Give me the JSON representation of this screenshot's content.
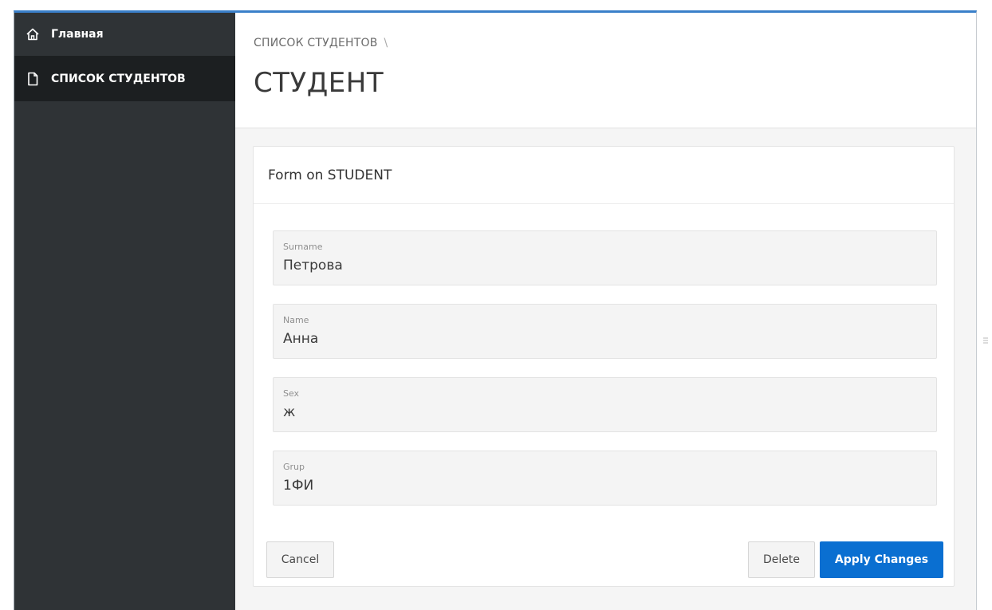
{
  "sidebar": {
    "items": [
      {
        "label": "Главная",
        "icon": "home-icon",
        "active": false
      },
      {
        "label": "СПИСОК СТУДЕНТОВ",
        "icon": "document-icon",
        "active": true
      }
    ]
  },
  "header": {
    "breadcrumb": "СПИСОК СТУДЕНТОВ",
    "breadcrumb_sep": "\\",
    "title": "СТУДЕНТ"
  },
  "form": {
    "title": "Form on STUDENT",
    "fields": [
      {
        "label": "Surname",
        "value": "Петрова"
      },
      {
        "label": "Name",
        "value": "Анна"
      },
      {
        "label": "Sex",
        "value": "ж"
      },
      {
        "label": "Grup",
        "value": "1ФИ"
      }
    ],
    "buttons": {
      "cancel": "Cancel",
      "delete": "Delete",
      "apply": "Apply Changes"
    }
  },
  "colors": {
    "sidebar_bg": "#2f3336",
    "active_item_bg": "#1c1f21",
    "primary_button": "#0a6fd1",
    "frame_top_border": "#3a7fc9"
  }
}
